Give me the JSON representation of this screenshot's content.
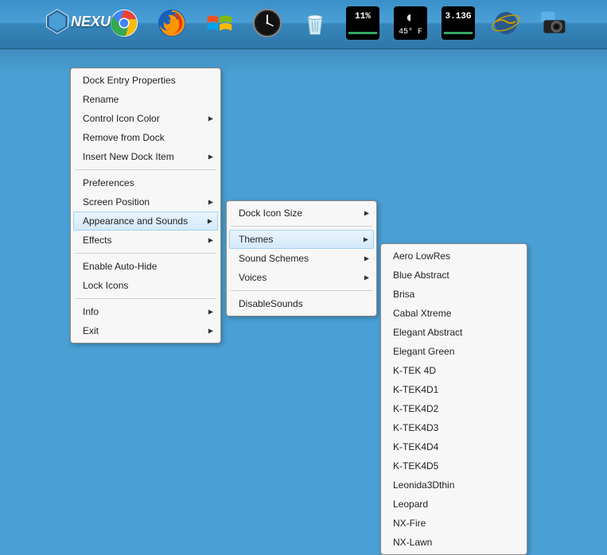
{
  "dock": {
    "logo_text": "NEXUS",
    "widgets": {
      "cpu": "11%",
      "ram": "3.13G",
      "temp": "45° F"
    }
  },
  "menu1": {
    "items": [
      {
        "label": "Dock Entry Properties",
        "sub": false
      },
      {
        "label": "Rename",
        "sub": false
      },
      {
        "label": "Control Icon Color",
        "sub": true
      },
      {
        "label": "Remove from Dock",
        "sub": false
      },
      {
        "label": "Insert New Dock Item",
        "sub": true
      }
    ],
    "items2": [
      {
        "label": "Preferences",
        "sub": false
      },
      {
        "label": "Screen Position",
        "sub": true
      },
      {
        "label": "Appearance and Sounds",
        "sub": true,
        "hl": true
      },
      {
        "label": "Effects",
        "sub": true
      }
    ],
    "items3": [
      {
        "label": "Enable Auto-Hide",
        "sub": false
      },
      {
        "label": "Lock Icons",
        "sub": false
      }
    ],
    "items4": [
      {
        "label": "Info",
        "sub": true
      },
      {
        "label": "Exit",
        "sub": true
      }
    ]
  },
  "menu2": {
    "items": [
      {
        "label": "Dock Icon Size",
        "sub": true
      }
    ],
    "items2": [
      {
        "label": "Themes",
        "sub": true,
        "hl": true
      },
      {
        "label": "Sound Schemes",
        "sub": true
      },
      {
        "label": "Voices",
        "sub": true
      }
    ],
    "items3": [
      {
        "label": "DisableSounds",
        "sub": false
      }
    ]
  },
  "menu3": {
    "items": [
      "Aero LowRes",
      "Blue Abstract",
      "Brisa",
      "Cabal Xtreme",
      "Elegant Abstract",
      "Elegant Green",
      "K-TEK 4D",
      "K-TEK4D1",
      "K-TEK4D2",
      "K-TEK4D3",
      "K-TEK4D4",
      "K-TEK4D5",
      "Leonida3Dthin",
      "Leopard",
      "NX-Fire",
      "NX-Lawn"
    ]
  }
}
